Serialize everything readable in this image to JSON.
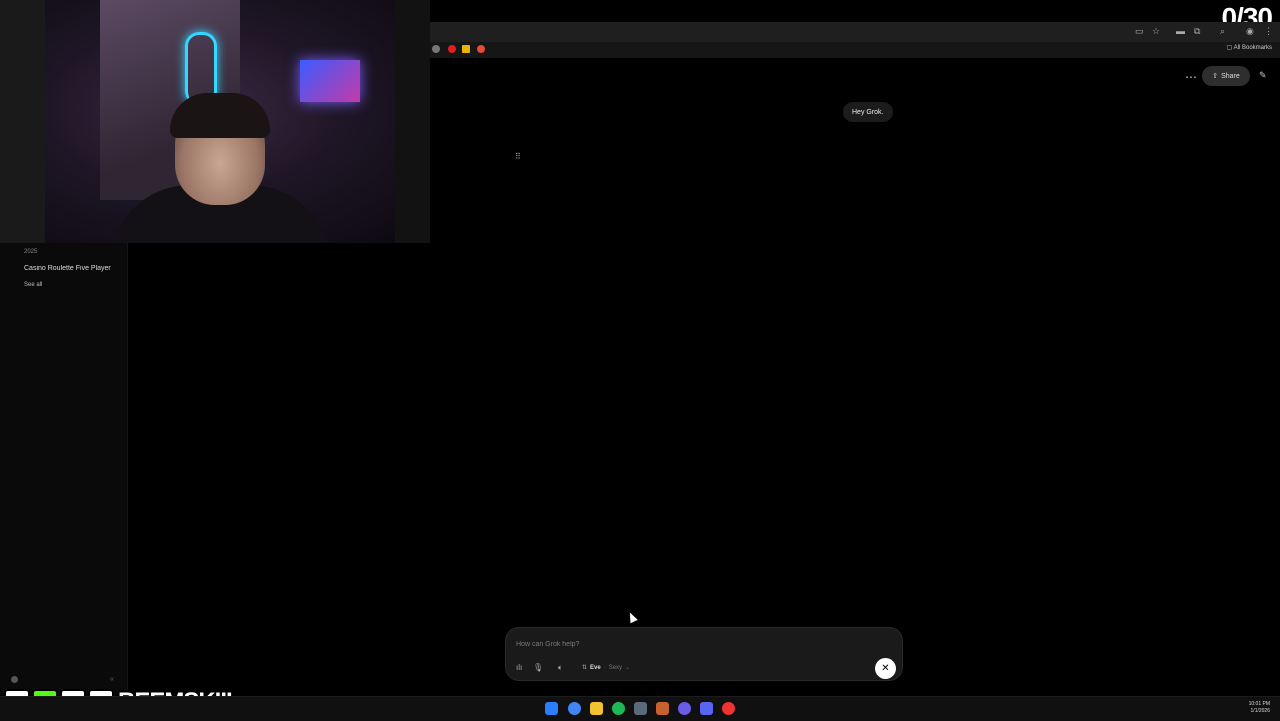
{
  "overlay": {
    "counter": "0/30",
    "handle": "BEEMSKIII",
    "socials": [
      "twitch-icon",
      "kick-icon",
      "x-icon",
      "instagram-icon"
    ]
  },
  "browser": {
    "bookmarks_label": "All Bookmarks"
  },
  "sidebar": {
    "year": "2025",
    "items": [
      {
        "label": "Casino Roulette Five Player"
      }
    ],
    "see_all": "See all"
  },
  "header": {
    "share_label": "Share"
  },
  "chat": {
    "messages": [
      {
        "role": "user",
        "text": "Hey Grok."
      }
    ]
  },
  "composer": {
    "placeholder": "How can Grok help?",
    "voice": "Eve",
    "style": "Sexy"
  },
  "taskbar": {
    "time": "10:01 PM",
    "date": "1/1/2026"
  },
  "colors": {
    "background": "#000000",
    "accent": "#ffffff",
    "bubble": "#1c1c1c"
  }
}
